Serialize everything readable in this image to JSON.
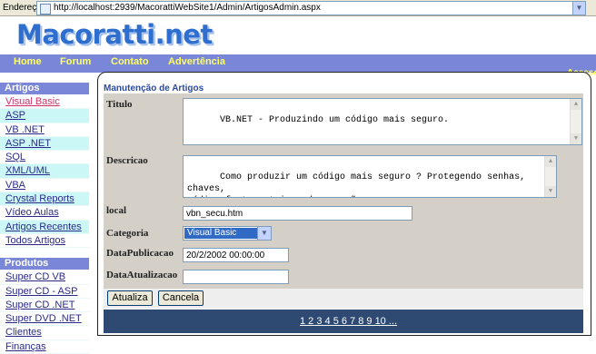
{
  "addressbar": {
    "label": "Endereço",
    "url": "http://localhost:2939/MacorattiWebSite1/Admin/ArtigosAdmin.aspx"
  },
  "logo": "Macoratti.net",
  "nav": {
    "home": "Home",
    "forum": "Forum",
    "contato": "Contato",
    "advertencia": "Advertência",
    "acesso": "Acesso"
  },
  "sidebar": {
    "artigos_title": "Artigos",
    "artigos": [
      "Visual Basic",
      "ASP",
      "VB .NET",
      "ASP .NET",
      "SQL",
      "XML/UML",
      "VBA",
      "Crystal Reports",
      "Vídeo Aulas",
      "Artigos Recentes",
      "Todos Artigos"
    ],
    "produtos_title": "Produtos",
    "produtos": [
      "Super CD VB",
      "Super CD - ASP",
      "Super CD .NET",
      "Super DVD .NET",
      "Clientes",
      "Finanças"
    ]
  },
  "form": {
    "heading": "Manutenção de Artigos",
    "titulo_label": "Titulo",
    "titulo_value": "VB.NET - Produzindo um código mais seguro.",
    "descricao_label": "Descricao",
    "descricao_value": "Como produzir um código mais seguro ? Protegendo senhas, chaves,\ncódigo fonte, strings de conexão.",
    "local_label": "local",
    "local_value": "vbn_secu.htm",
    "categoria_label": "Categoria",
    "categoria_value": "Visual Basic",
    "datapub_label": "DataPublicacao",
    "datapub_value": "20/2/2002 00:00:00",
    "dataatu_label": "DataAtualizacao",
    "dataatu_value": "",
    "atualiza": "Atualiza",
    "cancela": "Cancela"
  },
  "pager": {
    "pages": "1 2 3 4 5 6 7 8 9 10 ..."
  }
}
